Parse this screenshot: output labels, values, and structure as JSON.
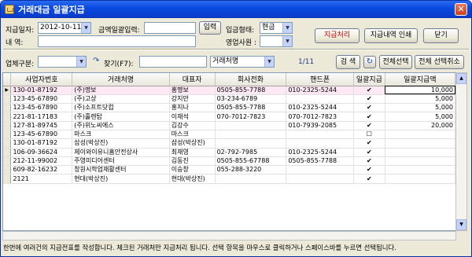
{
  "window": {
    "title": "거래대금 일괄지급",
    "close_glyph": "✕"
  },
  "form": {
    "pay_date_label": "지급일자:",
    "pay_date_value": "2012-10-11",
    "amount_label": "금액일괄입력:",
    "amount_value": "",
    "input_button": "입력",
    "deposit_type_label": "입금형태:",
    "deposit_type_value": "현금",
    "memo_label": "내    역:",
    "memo_value": "",
    "sales_staff_label": "영업사원 :",
    "sales_staff_value": ""
  },
  "buttons": {
    "process": "지급처리",
    "print": "지급내역 인쇄",
    "close": "닫기"
  },
  "filter": {
    "biz_type_label": "업체구분:",
    "biz_type_value": "",
    "search_label": "찾기(F7):",
    "search_value": "",
    "search_field_value": "거래처명",
    "page_info": "1/11",
    "search_button": "검 색",
    "select_all_button": "전체선택",
    "deselect_all_button": "전체 선택취소"
  },
  "table": {
    "columns": [
      "사업자번호",
      "거래처명",
      "대표자",
      "회사전화",
      "핸드폰",
      "일괄지급",
      "일괄지급액"
    ],
    "rows": [
      {
        "biz_no": "130-01-87192",
        "name": "(주)명보",
        "ceo": "홍명보",
        "phone": "0505-855-7788",
        "mobile": "010-2325-5244",
        "checked": true,
        "amount": "10,000"
      },
      {
        "biz_no": "123-45-67890",
        "name": "(주)고상",
        "ceo": "강지만",
        "phone": "03-234-6789",
        "mobile": "",
        "checked": true,
        "amount": "5,000"
      },
      {
        "biz_no": "123-45-67890",
        "name": "(주)소프트닷컴",
        "ceo": "홍지나",
        "phone": "0505-855-7788",
        "mobile": "010-2325-5244",
        "checked": true,
        "amount": "5,000"
      },
      {
        "biz_no": "221-81-17183",
        "name": "(주)홀렌탑",
        "ceo": "이재석",
        "phone": "070-7012-7823",
        "mobile": "070-7012-7823",
        "checked": true,
        "amount": "5,000"
      },
      {
        "biz_no": "127-81-89745",
        "name": "(주)위노씨에스",
        "ceo": "김강수",
        "phone": "",
        "mobile": "010-7939-2085",
        "checked": true,
        "amount": "20,000"
      },
      {
        "biz_no": "123-45-67890",
        "name": "마스크",
        "ceo": "마스크",
        "phone": "",
        "mobile": "",
        "checked": false,
        "amount": ""
      },
      {
        "biz_no": "130-01-87192",
        "name": "삼성(박상진)",
        "ceo": "삼성(박상진)",
        "phone": "",
        "mobile": "",
        "checked": true,
        "amount": ""
      },
      {
        "biz_no": "106-09-36624",
        "name": "제이와이유니홈안전상사",
        "ceo": "최재영",
        "phone": "02-792-7985",
        "mobile": "010-2325-5244",
        "checked": true,
        "amount": ""
      },
      {
        "biz_no": "212-11-99002",
        "name": "주영미디어센터",
        "ceo": "김동진",
        "phone": "0505-855-67788",
        "mobile": "0505-855-7788",
        "checked": true,
        "amount": ""
      },
      {
        "biz_no": "609-82-16232",
        "name": "창원시학업재활센터",
        "ceo": "이승창",
        "phone": "055-288-3220",
        "mobile": "",
        "checked": true,
        "amount": ""
      },
      {
        "biz_no": "2121",
        "name": "현대(박상진)",
        "ceo": "현대(박상진)",
        "phone": "",
        "mobile": "",
        "checked": true,
        "amount": ""
      }
    ]
  },
  "status_text": "한번에 여러건의 지급전표를 작성합니다. 체크된 거래처만 지급처리 됩니다. 선택 항목을 마우스로 클릭하거나 스페이스바를 누르면 선택됩니다.",
  "icons": {
    "refresh": "refresh-icon",
    "calendar_arrow": "chevron-down-icon",
    "search_arrow": "redo-arrow-icon"
  },
  "colors": {
    "titlebar": "#0a4be0",
    "process_button_text": "#c00000",
    "active_row": "#fde8f4"
  }
}
